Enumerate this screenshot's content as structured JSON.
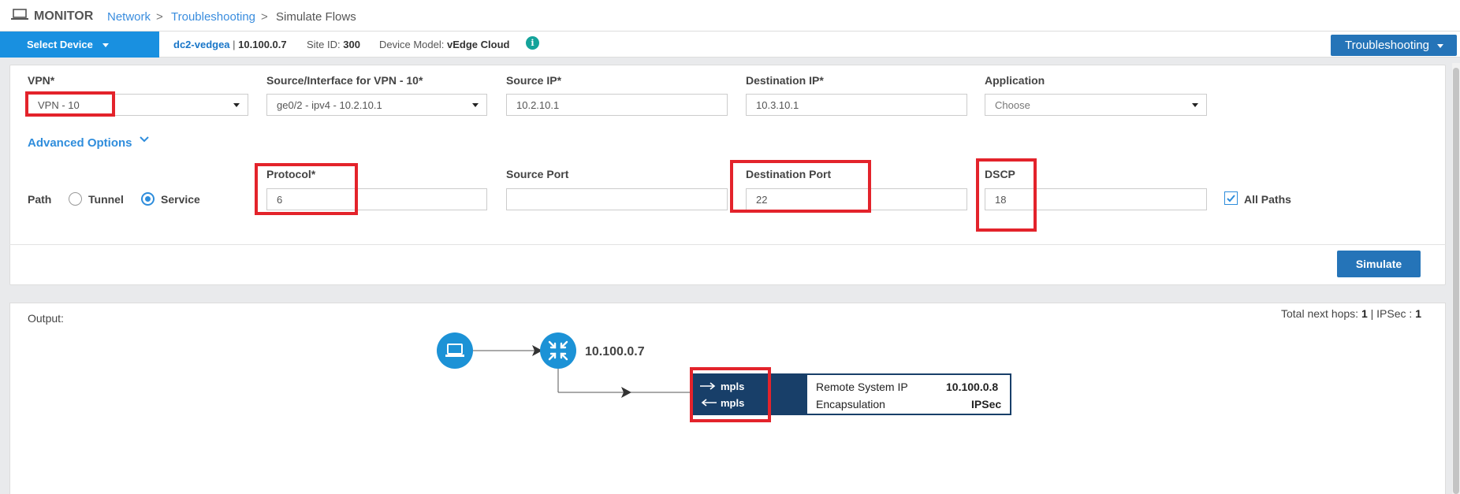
{
  "header": {
    "app_title": "MONITOR",
    "breadcrumb": [
      "Network",
      "Troubleshooting",
      "Simulate Flows"
    ],
    "separator": ">"
  },
  "device_bar": {
    "select_label": "Select Device",
    "device_name": "dc2-vedgea",
    "device_ip": "10.100.0.7",
    "site_id_label": "Site ID:",
    "site_id": "300",
    "model_label": "Device Model:",
    "model": "vEdge Cloud",
    "info_glyph": "i",
    "troubleshooting_label": "Troubleshooting"
  },
  "form": {
    "vpn": {
      "label": "VPN*",
      "value": "VPN - 10"
    },
    "source_interface": {
      "label": "Source/Interface for VPN - 10*",
      "value": "ge0/2 - ipv4 - 10.2.10.1"
    },
    "source_ip": {
      "label": "Source IP*",
      "value": "10.2.10.1"
    },
    "destination_ip": {
      "label": "Destination IP*",
      "value": "10.3.10.1"
    },
    "application": {
      "label": "Application",
      "placeholder": "Choose"
    },
    "advanced_options_label": "Advanced Options",
    "path": {
      "label": "Path",
      "options": [
        "Tunnel",
        "Service"
      ],
      "selected": "Service"
    },
    "protocol": {
      "label": "Protocol*",
      "value": "6"
    },
    "source_port": {
      "label": "Source Port",
      "value": ""
    },
    "destination_port": {
      "label": "Destination Port",
      "value": "22"
    },
    "dscp": {
      "label": "DSCP",
      "value": "18"
    },
    "all_paths": {
      "label": "All Paths",
      "checked": true
    },
    "simulate_label": "Simulate"
  },
  "output": {
    "label": "Output:",
    "total_next_hops_label": "Total next hops:",
    "total_next_hops": "1",
    "divider": "|",
    "ipsec_label": "IPSec :",
    "ipsec": "1",
    "hop_ip": "10.100.0.7",
    "tunnel": {
      "out_color": "mpls",
      "in_color": "mpls",
      "remote_ip_label": "Remote System IP",
      "remote_ip": "10.100.0.8",
      "encap_label": "Encapsulation",
      "encap": "IPSec"
    }
  },
  "colors": {
    "accent": "#1990e0",
    "button": "#2574b8",
    "highlight": "#e3232b",
    "tunnel": "#183f69",
    "node": "#1c92d6"
  },
  "icons": [
    "laptop-icon",
    "caret-down-icon",
    "info-icon",
    "chevron-down-icon",
    "router-icon",
    "arrow-right-icon",
    "arrow-left-icon",
    "check-icon"
  ]
}
